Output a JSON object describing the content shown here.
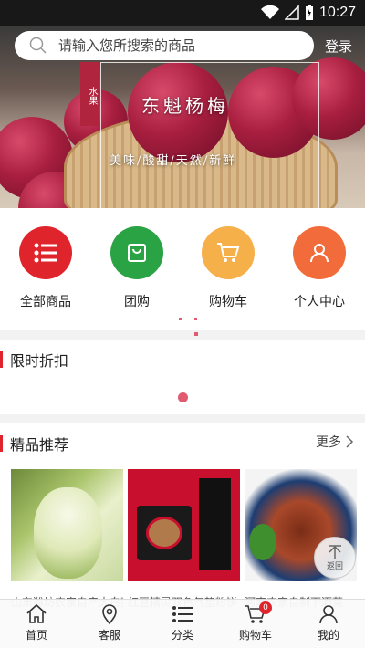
{
  "status_bar": {
    "time": "10:27"
  },
  "search": {
    "placeholder": "请输入您所搜索的商品"
  },
  "header": {
    "login_label": "登录"
  },
  "banner": {
    "tag": "水果",
    "title": "东魁杨梅",
    "subtitle": "美味/酸甜/天然/新鲜"
  },
  "categories": [
    {
      "label": "全部商品",
      "icon": "list-icon",
      "color": "#e0242c"
    },
    {
      "label": "团购",
      "icon": "shopping-bag-icon",
      "color": "#2aa344"
    },
    {
      "label": "购物车",
      "icon": "cart-icon",
      "color": "#f6b04a"
    },
    {
      "label": "个人中心",
      "icon": "user-icon",
      "color": "#f26b3a"
    }
  ],
  "flash_sale": {
    "title": "限时折扣"
  },
  "recommend": {
    "title": "精品推荐",
    "more_label": "更多",
    "products": [
      {
        "name": "山东潍坊农家自产大白菜"
      },
      {
        "name": "红豆精灵双色气垫粉饼"
      },
      {
        "name": "河南农家自制下酒菜"
      }
    ]
  },
  "back_to_top": {
    "label": "返回"
  },
  "bottom_nav": [
    {
      "label": "首页",
      "icon": "home-icon"
    },
    {
      "label": "客服",
      "icon": "location-pin-icon"
    },
    {
      "label": "分类",
      "icon": "list-icon"
    },
    {
      "label": "购物车",
      "icon": "cart-icon",
      "badge": "0"
    },
    {
      "label": "我的",
      "icon": "user-icon"
    }
  ]
}
